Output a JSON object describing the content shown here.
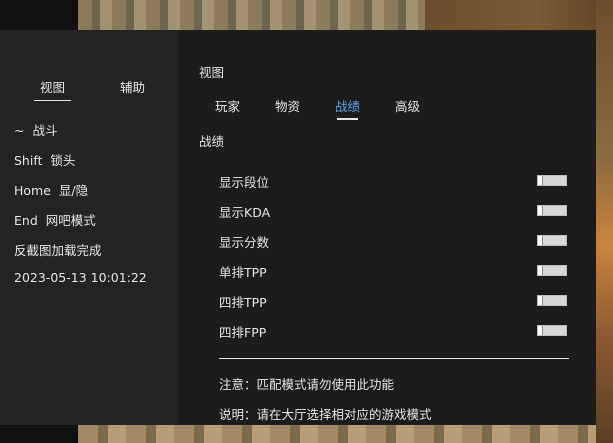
{
  "left": {
    "tabs": [
      "视图",
      "辅助"
    ],
    "hotkeys": [
      {
        "key": "~",
        "action": "战斗"
      },
      {
        "key": "Shift",
        "action": "锁头"
      },
      {
        "key": "Home",
        "action": "显/隐"
      },
      {
        "key": "End",
        "action": "网吧模式"
      }
    ],
    "status": "反截图加载完成",
    "datetime": "2023-05-13 10:01:22"
  },
  "right": {
    "title": "视图",
    "tabs": [
      "玩家",
      "物资",
      "战绩",
      "高级"
    ],
    "active_tab": "战绩",
    "section_title": "战绩",
    "options": [
      {
        "label": "显示段位",
        "enabled": false
      },
      {
        "label": "显示KDA",
        "enabled": false
      },
      {
        "label": "显示分数",
        "enabled": false
      },
      {
        "label": "单排TPP",
        "enabled": false
      },
      {
        "label": "四排TPP",
        "enabled": false
      },
      {
        "label": "四排FPP",
        "enabled": false
      }
    ],
    "note": "注意：匹配模式请勿使用此功能",
    "explain": "说明：请在大厅选择相对应的游戏模式"
  },
  "colors": {
    "active_tab": "#5aa0e8",
    "panel_left": "#232323",
    "panel_right": "#1c1c1c"
  }
}
